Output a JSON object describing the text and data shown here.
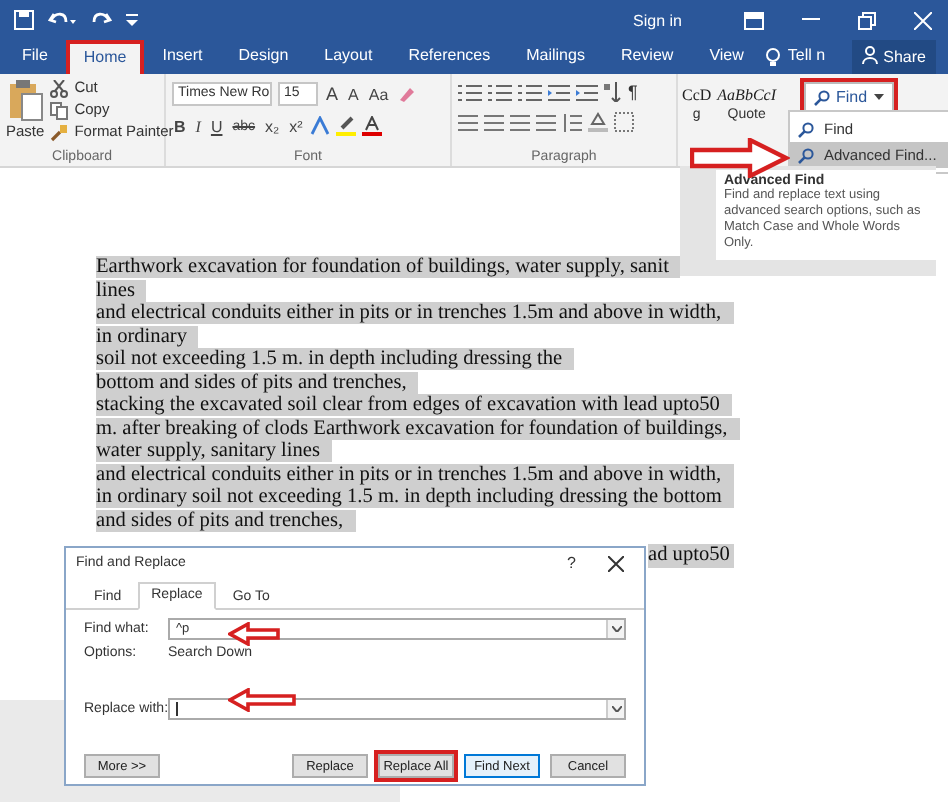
{
  "title_bar": {
    "sign_in": "Sign in"
  },
  "tabs": [
    {
      "label": "File",
      "selected": false,
      "annotated": false
    },
    {
      "label": "Home",
      "selected": true,
      "annotated": true
    },
    {
      "label": "Insert",
      "selected": false,
      "annotated": false
    },
    {
      "label": "Design",
      "selected": false,
      "annotated": false
    },
    {
      "label": "Layout",
      "selected": false,
      "annotated": false
    },
    {
      "label": "References",
      "selected": false,
      "annotated": false
    },
    {
      "label": "Mailings",
      "selected": false,
      "annotated": false
    },
    {
      "label": "Review",
      "selected": false,
      "annotated": false
    },
    {
      "label": "View",
      "selected": false,
      "annotated": false
    }
  ],
  "tell_me": "Tell n",
  "share": "Share",
  "clipboard": {
    "paste": "Paste",
    "items": [
      "Cut",
      "Copy",
      "Format Painter"
    ],
    "label": "Clipboard"
  },
  "font": {
    "name": "Times New Ro",
    "size": "15",
    "row1": [
      "A",
      "A",
      "Aa"
    ],
    "row2": [
      "B",
      "I",
      "U",
      "abc",
      "x₂",
      "x²"
    ],
    "label": "Font"
  },
  "paragraph": {
    "label": "Paragraph",
    "mark": "¶"
  },
  "styles": [
    {
      "sample": "CcD",
      "name": "g",
      "italic": false
    },
    {
      "sample": "AaBbCcI",
      "name": "Quote",
      "italic": true
    }
  ],
  "find_button": {
    "label": "Find",
    "annotated": true
  },
  "find_menu": [
    {
      "label": "Find",
      "selected": false
    },
    {
      "label": "Advanced Find...",
      "selected": true
    }
  ],
  "tooltip": {
    "title": "Advanced Find",
    "text": "Find and replace text using advanced search options, such as Match Case and Whole Words Only."
  },
  "document": {
    "lines": [
      "Earthwork excavation for foundation of buildings, water supply, sanit",
      "lines",
      "and electrical conduits either in pits or in trenches 1.5m and above in width,",
      "in ordinary",
      "soil not exceeding 1.5 m. in depth including dressing the",
      "bottom and sides of pits  and trenches,",
      "stacking the excavated soil clear from edges of excavation with lead upto50",
      "m. after breaking of clods Earthwork excavation for foundation of buildings,",
      "water supply, sanitary lines",
      "and electrical conduits either in pits or in trenches 1.5m and above in width,",
      "in ordinary soil not exceeding 1.5 m. in depth including dressing the bottom",
      "and sides of pits  and trenches,"
    ],
    "fragment": "ad upto50"
  },
  "dialog": {
    "title": "Find and Replace",
    "help": "?",
    "tabs": [
      {
        "label": "Find",
        "selected": false
      },
      {
        "label": "Replace",
        "selected": true
      },
      {
        "label": "Go To",
        "selected": false
      }
    ],
    "find_label": "Find what:",
    "find_value": "^p",
    "options_label": "Options:",
    "options_value": "Search Down",
    "replace_label": "Replace with:",
    "buttons": [
      {
        "label": "More >>",
        "default": false,
        "annotated": false
      },
      {
        "label": "Replace",
        "default": false,
        "annotated": false
      },
      {
        "label": "Replace All",
        "default": false,
        "annotated": true
      },
      {
        "label": "Find Next",
        "default": true,
        "annotated": false
      },
      {
        "label": "Cancel",
        "default": false,
        "annotated": false
      }
    ]
  }
}
